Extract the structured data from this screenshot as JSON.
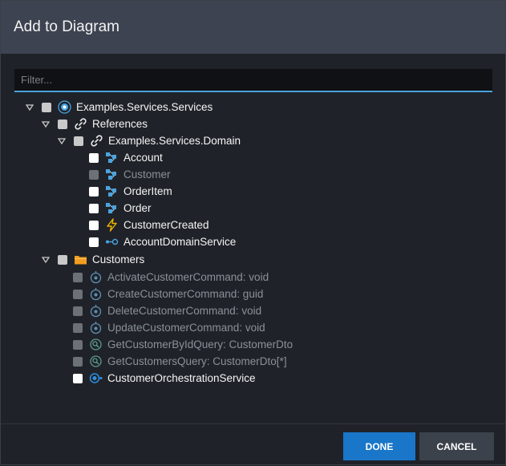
{
  "dialog": {
    "title": "Add to Diagram",
    "filter_placeholder": "Filter...",
    "done_label": "DONE",
    "cancel_label": "CANCEL"
  },
  "tree": {
    "root": {
      "label": "Examples.Services.Services",
      "icon": "service-package-icon"
    },
    "references": {
      "label": "References",
      "icon": "link-icon"
    },
    "domain": {
      "label": "Examples.Services.Domain",
      "icon": "link-icon"
    },
    "domain_items": [
      {
        "label": "Account",
        "icon": "class-icon",
        "state": "unchecked"
      },
      {
        "label": "Customer",
        "icon": "class-icon",
        "state": "disabled"
      },
      {
        "label": "OrderItem",
        "icon": "class-icon",
        "state": "unchecked"
      },
      {
        "label": "Order",
        "icon": "class-icon",
        "state": "unchecked"
      },
      {
        "label": "CustomerCreated",
        "icon": "lightning-icon",
        "state": "unchecked"
      },
      {
        "label": "AccountDomainService",
        "icon": "domain-service-icon",
        "state": "unchecked"
      }
    ],
    "customers": {
      "label": "Customers",
      "icon": "folder-icon"
    },
    "customer_items": [
      {
        "label": "ActivateCustomerCommand: void",
        "icon": "command-icon",
        "state": "disabled"
      },
      {
        "label": "CreateCustomerCommand: guid",
        "icon": "command-icon",
        "state": "disabled"
      },
      {
        "label": "DeleteCustomerCommand: void",
        "icon": "command-icon",
        "state": "disabled"
      },
      {
        "label": "UpdateCustomerCommand: void",
        "icon": "command-icon",
        "state": "disabled"
      },
      {
        "label": "GetCustomerByIdQuery: CustomerDto",
        "icon": "query-icon",
        "state": "disabled"
      },
      {
        "label": "GetCustomersQuery: CustomerDto[*]",
        "icon": "query-icon",
        "state": "disabled"
      },
      {
        "label": "CustomerOrchestrationService",
        "icon": "service-icon",
        "state": "unchecked"
      }
    ]
  },
  "colors": {
    "accent": "#4aa3df",
    "primary_button": "#1976c9",
    "header": "#3d4350"
  }
}
